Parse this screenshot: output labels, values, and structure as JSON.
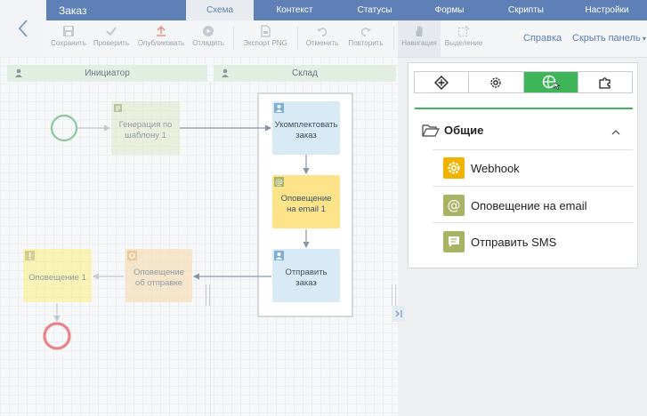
{
  "header": {
    "title": "Заказ",
    "tabs": [
      {
        "label": "Схема",
        "active": true
      },
      {
        "label": "Контекст",
        "active": false
      },
      {
        "label": "Статусы",
        "active": false
      },
      {
        "label": "Формы",
        "active": false
      },
      {
        "label": "Скрипты",
        "active": false
      },
      {
        "label": "Настройки",
        "active": false
      }
    ]
  },
  "toolbar": {
    "save": "Сохранить",
    "check": "Проверить",
    "publish": "Опубликовать",
    "debug": "Отладить",
    "export": "Экспорт PNG",
    "undo": "Отменить",
    "redo": "Повторить",
    "navigation": "Навигация",
    "select": "Выделение",
    "help": "Справка",
    "hide_panel": "Скрыть панель"
  },
  "lanes": [
    "Инициатор",
    "Склад"
  ],
  "nodes": {
    "generate": "Генерация по шаблону 1",
    "assemble": "Укомплектовать заказ",
    "email_notify": "Оповещение на email 1",
    "send": "Отправить заказ",
    "ship_notify": "Оповещение об отправке",
    "notify1": "Оповещение 1"
  },
  "panel": {
    "group": "Общие",
    "items": [
      {
        "label": "Webhook",
        "icon": "gear-icon",
        "color": "#f0b400"
      },
      {
        "label": "Оповещение на email",
        "icon": "at-icon",
        "color": "#a8b464"
      },
      {
        "label": "Отправить SMS",
        "icon": "message-icon",
        "color": "#a8b464"
      }
    ]
  },
  "colors": {
    "accent": "#5e80b6",
    "active_tab_green": "#3fb55a",
    "node_blue": "#d7eaf5",
    "node_yellow": "#fde48a",
    "start": "#8fc79c",
    "end": "#e8838a"
  }
}
